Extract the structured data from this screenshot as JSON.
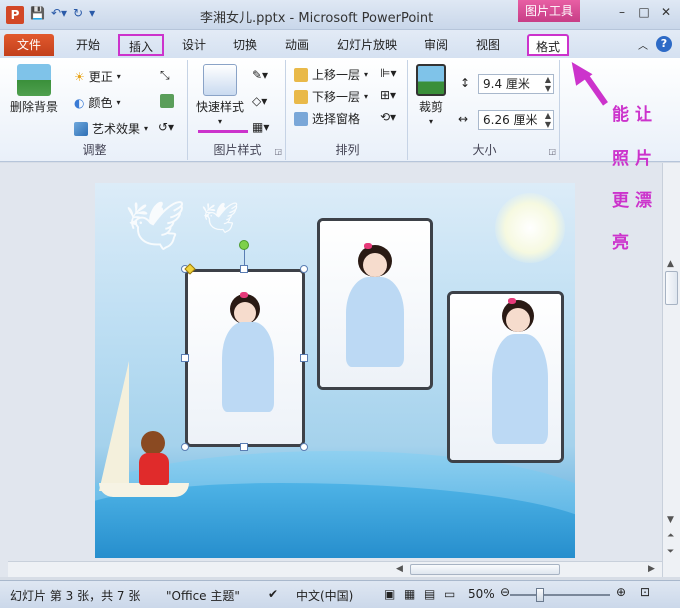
{
  "window": {
    "title": "李湘女儿.pptx - Microsoft PowerPoint",
    "app_icon_letter": "P",
    "context_group": "图片工具"
  },
  "tabs": [
    {
      "label": "文件"
    },
    {
      "label": "开始"
    },
    {
      "label": "插入"
    },
    {
      "label": "设计"
    },
    {
      "label": "切换"
    },
    {
      "label": "动画"
    },
    {
      "label": "幻灯片放映"
    },
    {
      "label": "审阅"
    },
    {
      "label": "视图"
    },
    {
      "label": "格式"
    }
  ],
  "ribbon": {
    "adjust": {
      "label": "调整",
      "remove_bg": "删除背景",
      "correct": "更正",
      "color": "颜色",
      "artistic": "艺术效果"
    },
    "picture_styles": {
      "label": "图片样式",
      "quick_styles": "快速样式"
    },
    "arrange": {
      "label": "排列",
      "bring_forward": "上移一层",
      "send_backward": "下移一层",
      "selection_pane": "选择窗格"
    },
    "size": {
      "label": "大小",
      "crop": "裁剪",
      "height": "9.4 厘米",
      "width": "6.26 厘米"
    }
  },
  "annotation": {
    "lines": [
      "能让",
      "照片",
      "更漂",
      "亮"
    ],
    "color": "#cc33cc"
  },
  "statusbar": {
    "slide_info": "幻灯片 第 3 张，共 7 张",
    "theme": "\"Office 主题\"",
    "language": "中文(中国)",
    "zoom": "50%"
  },
  "colors": {
    "file_tab": "#d24726",
    "highlight": "#cc33cc",
    "context_tab": "#d84e95"
  }
}
